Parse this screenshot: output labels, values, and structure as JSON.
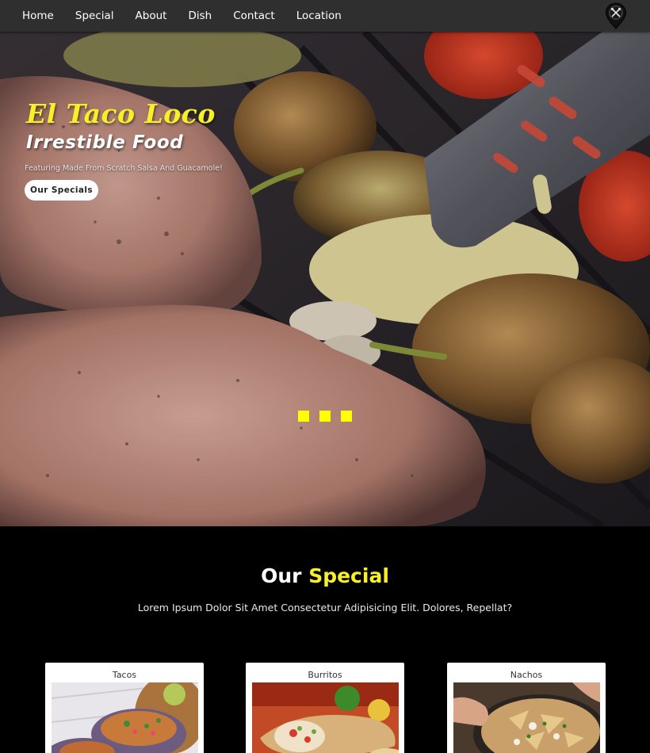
{
  "nav": {
    "items": [
      {
        "label": "Home"
      },
      {
        "label": "Special"
      },
      {
        "label": "About"
      },
      {
        "label": "Dish"
      },
      {
        "label": "Contact"
      },
      {
        "label": "Location"
      }
    ],
    "logo_icon": "fork-knife-pin-icon"
  },
  "hero": {
    "title": "El Taco Loco",
    "subtitle": "Irrestible Food",
    "description": "Featuring Made From Scratch Salsa And Guacamole!",
    "button_label": "Our Specials",
    "slide_dots": 3,
    "colors": {
      "title": "#f7f028",
      "dots": "#ffff00"
    }
  },
  "special": {
    "title_plain": "Our",
    "title_accent": "Special",
    "description": "Lorem Ipsum Dolor Sit Amet Consectetur Adipisicing Elit. Dolores, Repellat?",
    "cards": [
      {
        "label": "Tacos"
      },
      {
        "label": "Burritos"
      },
      {
        "label": "Nachos"
      }
    ]
  }
}
